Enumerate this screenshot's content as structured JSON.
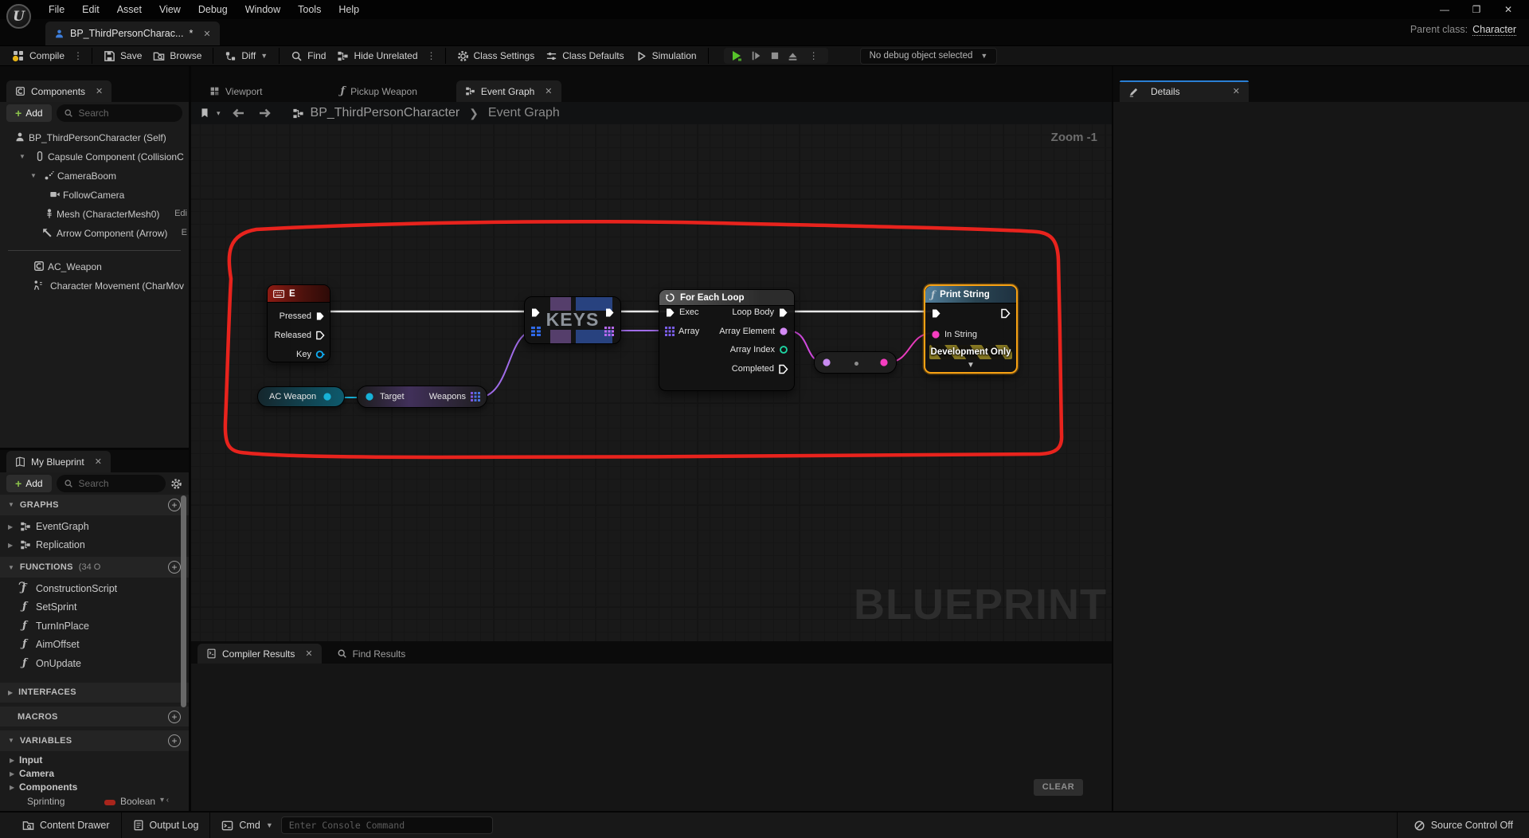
{
  "window": {
    "logo": "U",
    "menus": [
      "File",
      "Edit",
      "Asset",
      "View",
      "Debug",
      "Window",
      "Tools",
      "Help"
    ],
    "asset_tab": {
      "label": "BP_ThirdPersonCharac...",
      "dirty": "*"
    },
    "parent_class": {
      "label": "Parent class:",
      "value": "Character"
    }
  },
  "toolbar": {
    "compile": "Compile",
    "save": "Save",
    "browse": "Browse",
    "diff": "Diff",
    "find": "Find",
    "hide_unrelated": "Hide Unrelated",
    "class_settings": "Class Settings",
    "class_defaults": "Class Defaults",
    "simulation": "Simulation",
    "debug_select": "No debug object selected"
  },
  "components": {
    "tab": "Components",
    "add": "Add",
    "search": "Search",
    "rows": [
      {
        "label": "BP_ThirdPersonCharacter (Self)"
      },
      {
        "label": "Capsule Component (CollisionC"
      },
      {
        "label": "CameraBoom"
      },
      {
        "label": "FollowCamera"
      },
      {
        "label": "Mesh (CharacterMesh0)",
        "link": "Edi"
      },
      {
        "label": "Arrow Component (Arrow)",
        "link": "E"
      },
      {
        "label": "AC_Weapon"
      },
      {
        "label": "Character Movement (CharMov"
      }
    ]
  },
  "my_blueprint": {
    "tab": "My Blueprint",
    "add": "Add",
    "search": "Search",
    "sections": {
      "graphs": "GRAPHS",
      "functions": "FUNCTIONS",
      "functions_count": "(34 O",
      "interfaces": "INTERFACES",
      "macros": "MACROS",
      "variables": "VARIABLES"
    },
    "graphs": [
      {
        "label": "EventGraph"
      },
      {
        "label": "Replication"
      }
    ],
    "functions": [
      {
        "label": "ConstructionScript"
      },
      {
        "label": "SetSprint"
      },
      {
        "label": "TurnInPlace"
      },
      {
        "label": "AimOffset"
      },
      {
        "label": "OnUpdate"
      }
    ],
    "variable_categories": [
      {
        "label": "Input"
      },
      {
        "label": "Camera"
      },
      {
        "label": "Components"
      }
    ],
    "partial_variable": {
      "name": "Sprinting",
      "type": "Boolean"
    }
  },
  "graph": {
    "tabs": {
      "viewport": "Viewport",
      "pickup_weapon": "Pickup Weapon",
      "event_graph": "Event Graph"
    },
    "breadcrumb": {
      "root": "BP_ThirdPersonCharacter",
      "current": "Event Graph"
    },
    "zoom": "Zoom -1",
    "watermark": "BLUEPRINT",
    "nodes": {
      "key_event": {
        "title": "E",
        "pressed": "Pressed",
        "released": "Released",
        "key": "Key"
      },
      "get_ac_weapon": {
        "title": "AC Weapon"
      },
      "get_weapons": {
        "target": "Target",
        "weapons": "Weapons"
      },
      "map_keys": {
        "title": "KEYS"
      },
      "for_each": {
        "title": "For Each Loop",
        "exec": "Exec",
        "array": "Array",
        "loop_body": "Loop Body",
        "array_element": "Array Element",
        "array_index": "Array Index",
        "completed": "Completed"
      },
      "print_string": {
        "title": "Print String",
        "in_string": "In String",
        "banner": "Development Only"
      }
    },
    "colors": {
      "selection": "#f7a113",
      "exec_wire": "#e9e9e9",
      "object_pin": "#17b1d7",
      "purple_wire": "#a06ce8",
      "magenta_wire": "#e93cbe",
      "annotation": "#e8231d"
    }
  },
  "output": {
    "compiler_tab": "Compiler Results",
    "find_tab": "Find Results",
    "clear": "CLEAR"
  },
  "status_bar": {
    "content_drawer": "Content Drawer",
    "output_log": "Output Log",
    "cmd": "Cmd",
    "console_placeholder": "Enter Console Command",
    "source_control": "Source Control Off"
  }
}
